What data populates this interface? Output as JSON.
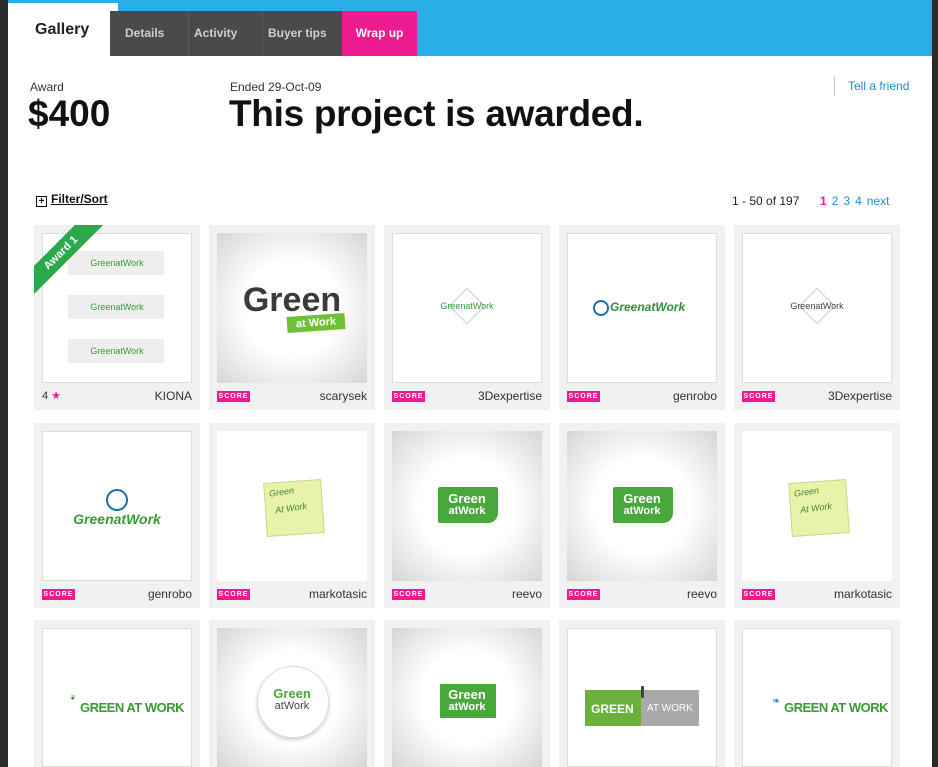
{
  "tabs": {
    "gallery": "Gallery",
    "details": "Details",
    "activity": "Activity",
    "buyer_tips": "Buyer tips",
    "wrap_up": "Wrap up"
  },
  "award": {
    "label": "Award",
    "amount": "$400"
  },
  "status": {
    "ended": "Ended 29-Oct-09",
    "headline": "This project is awarded."
  },
  "tell_friend": "Tell a friend",
  "filter_sort": "Filter/Sort",
  "pagination": {
    "range": "1 - 50 of 197",
    "pages": [
      "1",
      "2",
      "3",
      "4"
    ],
    "next": "next"
  },
  "score_label": "SCORE",
  "award_ribbon": "Award 1",
  "logo_text": {
    "greenatwork": "GreenatWork",
    "green": "Green",
    "at_work": "at Work",
    "atwork": "atWork",
    "green_at_work_caps": "GREEN AT WORK",
    "green_caps": "GREEN",
    "at_work_caps": "AT WORK",
    "green_caps_hand": "Green",
    "at_work_hand": "At Work"
  },
  "entries": [
    {
      "user": "KIONA",
      "rating": "4"
    },
    {
      "user": "scarysek"
    },
    {
      "user": "3Dexpertise"
    },
    {
      "user": "genrobo"
    },
    {
      "user": "3Dexpertise"
    },
    {
      "user": "genrobo"
    },
    {
      "user": "markotasic"
    },
    {
      "user": "reevo"
    },
    {
      "user": "reevo"
    },
    {
      "user": "markotasic"
    }
  ],
  "colors": {
    "accent_pink": "#ec1c8e",
    "header_blue": "#27aee7",
    "link_blue": "#1f8ccb",
    "logo_green": "#3a9a35"
  }
}
